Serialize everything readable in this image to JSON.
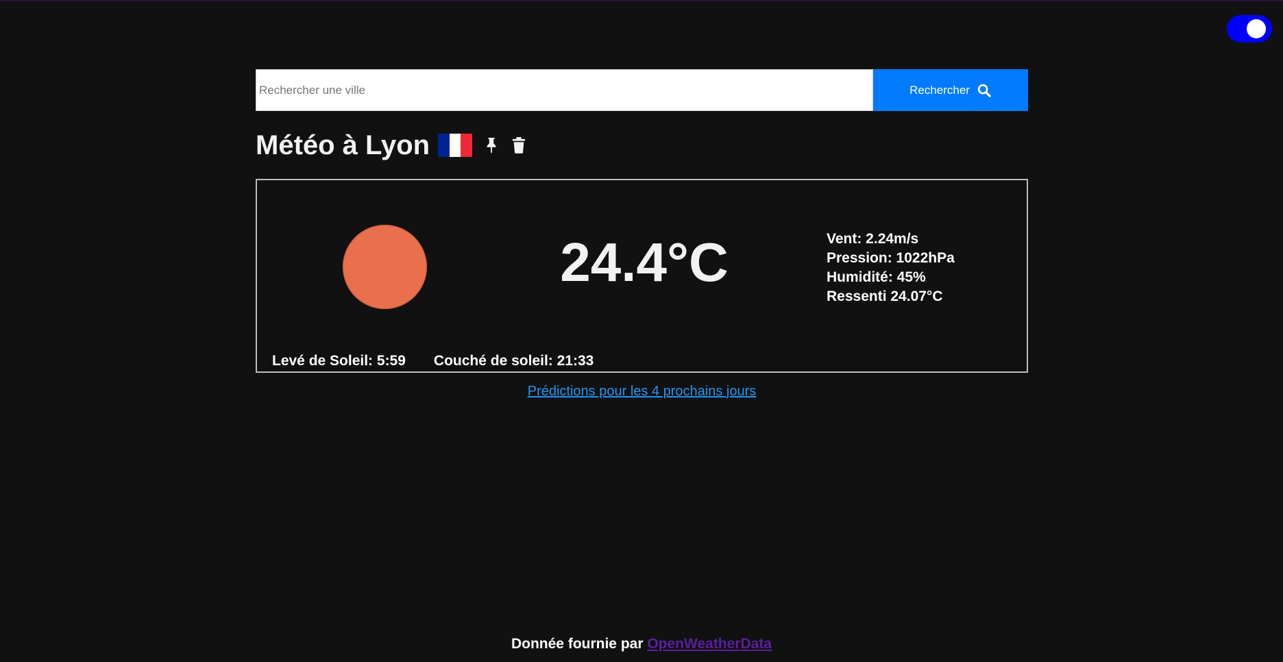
{
  "theme_toggle": {
    "state": "on",
    "color": "#0000ff"
  },
  "search": {
    "placeholder": "Rechercher une ville",
    "value": "",
    "button_label": "Rechercher",
    "button_color": "#007bff"
  },
  "city": {
    "title": "Météo à Lyon",
    "flag_colors": [
      "#002395",
      "#ffffff",
      "#ed2939"
    ],
    "icons": [
      "pin-icon",
      "trash-icon"
    ]
  },
  "weather": {
    "icon": "sun-icon",
    "icon_color": "#e8704c",
    "temperature": "24.4°C",
    "details": {
      "wind": "Vent: 2.24m/s",
      "pressure": "Pression: 1022hPa",
      "humidity": "Humidité: 45%",
      "feels_like": "Ressenti 24.07°C"
    },
    "sunrise": "Levé de Soleil: 5:59",
    "sunset": "Couché de soleil: 21:33"
  },
  "forecast_link": "Prédictions pour les 4 prochains jours",
  "footer": {
    "prefix": "Donnée fournie par ",
    "link": "OpenWeatherData"
  }
}
